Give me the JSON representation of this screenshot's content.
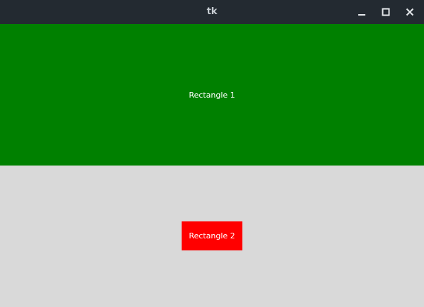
{
  "window": {
    "title": "tk",
    "controls": {
      "minimize_icon": "minimize-icon",
      "maximize_icon": "maximize-icon",
      "close_icon": "close-icon"
    }
  },
  "content": {
    "rectangle_1": {
      "label": "Rectangle 1",
      "color": "#008000"
    },
    "rectangle_2": {
      "label": "Rectangle 2",
      "color": "#ff0000"
    },
    "background_color": "#d9d9d9"
  }
}
